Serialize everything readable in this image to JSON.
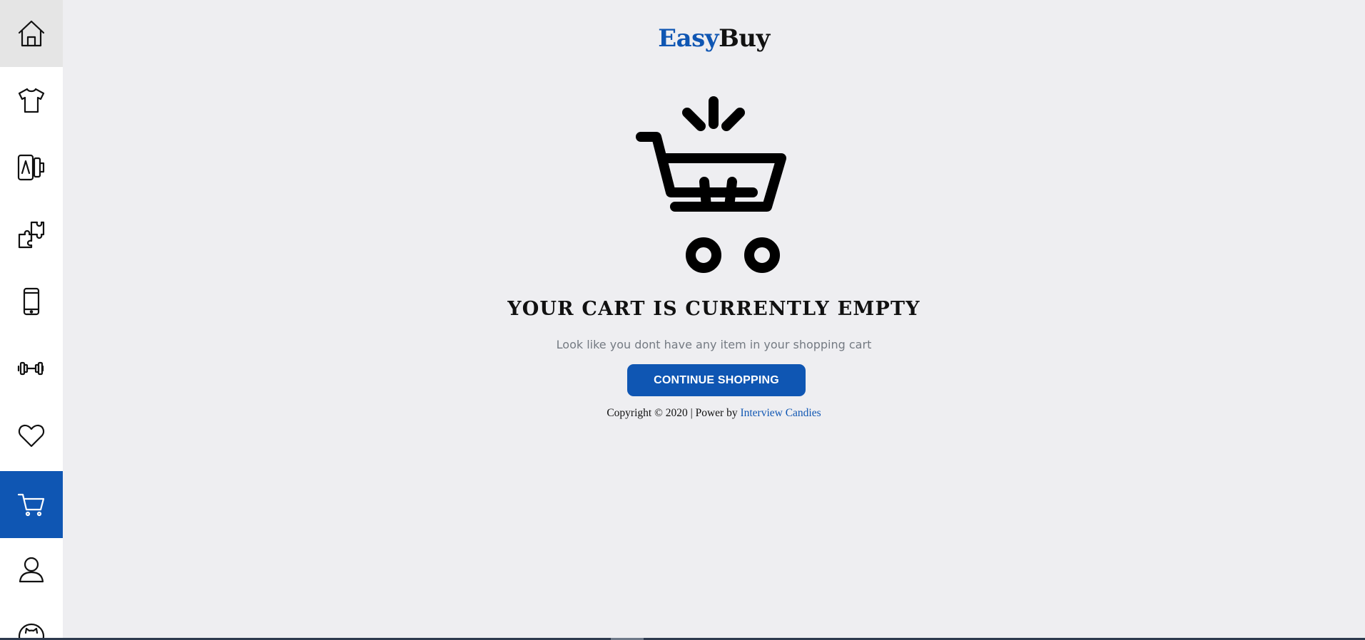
{
  "sidebar": {
    "items": [
      {
        "icon": "home-icon",
        "name": "sidebar-item-home"
      },
      {
        "icon": "tshirt-icon",
        "name": "sidebar-item-clothing"
      },
      {
        "icon": "appliances-icon",
        "name": "sidebar-item-appliances"
      },
      {
        "icon": "puzzle-icon",
        "name": "sidebar-item-toys"
      },
      {
        "icon": "smartphone-icon",
        "name": "sidebar-item-mobiles"
      },
      {
        "icon": "dumbbell-icon",
        "name": "sidebar-item-fitness"
      },
      {
        "icon": "heart-icon",
        "name": "sidebar-item-wishlist"
      },
      {
        "icon": "cart-icon",
        "name": "sidebar-item-cart",
        "active": true
      },
      {
        "icon": "user-icon",
        "name": "sidebar-item-profile"
      },
      {
        "icon": "github-icon",
        "name": "sidebar-item-github"
      }
    ],
    "active_color": "#0f56b3"
  },
  "header": {
    "logo_part1": "Easy",
    "logo_part2": "Buy"
  },
  "empty_cart": {
    "illustration_icon": "shopping-cart-icon",
    "title": "YOUR CART IS CURRENTLY EMPTY",
    "message": "Look like you dont have any item in your shopping cart",
    "button_label": "CONTINUE SHOPPING"
  },
  "footer": {
    "copyright": "Copyright © 2020 | Power by ",
    "link_text": "Interview Candies"
  },
  "colors": {
    "brand": "#0f56b3",
    "background": "#eeeef1",
    "text": "#111111",
    "muted": "#747a82"
  }
}
